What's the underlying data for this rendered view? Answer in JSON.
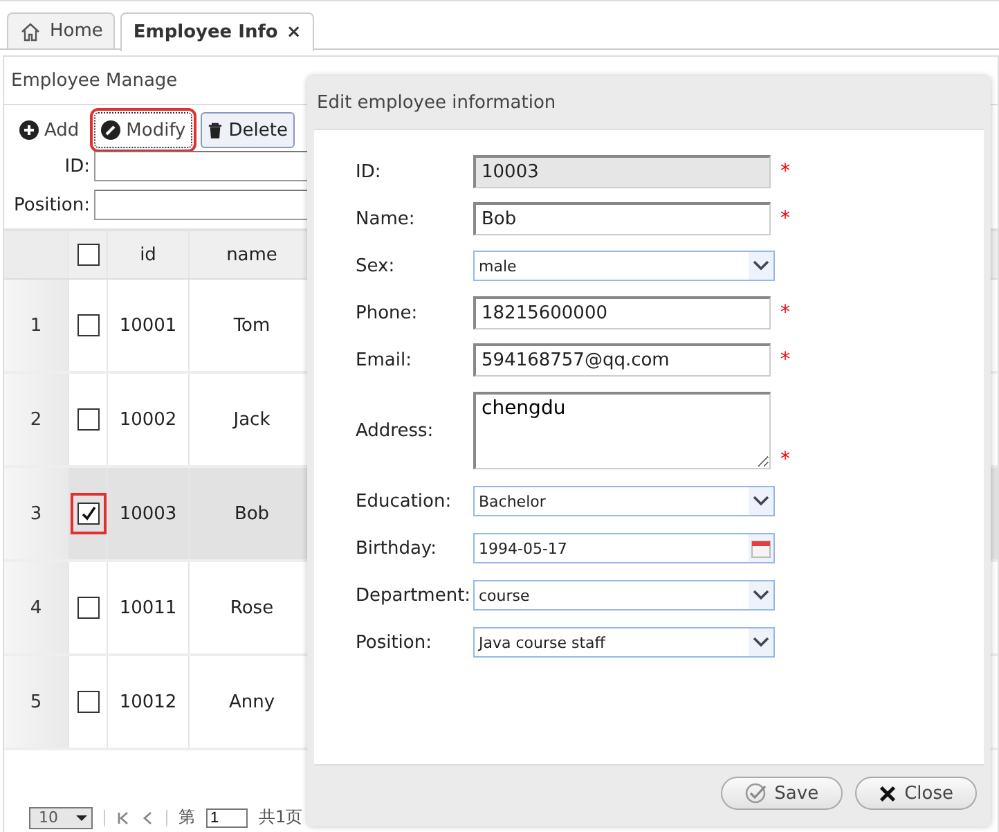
{
  "tabs": [
    {
      "label": "Home",
      "selected": false
    },
    {
      "label": "Employee Info",
      "close": "×",
      "selected": true
    }
  ],
  "panel": {
    "title": "Employee Manage",
    "toolbar": [
      {
        "label": "Add",
        "highlighted": false,
        "focused": false
      },
      {
        "label": "Modify",
        "highlighted": true,
        "focused": true
      },
      {
        "label": "Delete",
        "highlighted": false,
        "focused": false
      }
    ],
    "search": [
      {
        "label": "ID:"
      },
      {
        "label": "Position:"
      }
    ],
    "table": {
      "all_checked": false,
      "columns": [
        "id",
        "name"
      ],
      "rows": [
        {
          "num": "1",
          "checked": false,
          "selected": false,
          "highlighted": false,
          "cells": [
            "10001",
            "Tom"
          ]
        },
        {
          "num": "2",
          "checked": false,
          "selected": false,
          "highlighted": false,
          "cells": [
            "10002",
            "Jack"
          ]
        },
        {
          "num": "3",
          "checked": true,
          "selected": true,
          "highlighted": true,
          "cells": [
            "10003",
            "Bob"
          ]
        },
        {
          "num": "4",
          "checked": false,
          "selected": false,
          "highlighted": false,
          "cells": [
            "10011",
            "Rose"
          ]
        },
        {
          "num": "5",
          "checked": false,
          "selected": false,
          "highlighted": false,
          "cells": [
            "10012",
            "Anny"
          ]
        }
      ]
    },
    "pager": {
      "page_size": "10",
      "page_prefix": "第",
      "page": "1",
      "page_total": "共1页"
    }
  },
  "dialog": {
    "title": "Edit employee information",
    "fields": [
      {
        "label": "ID:",
        "kind": "readonly",
        "value": "10003",
        "required_mark": "*"
      },
      {
        "label": "Name:",
        "kind": "text",
        "value": "Bob",
        "required_mark": "*"
      },
      {
        "label": "Sex:",
        "kind": "select",
        "value": "male"
      },
      {
        "label": "Phone:",
        "kind": "text",
        "value": "18215600000",
        "required_mark": "*"
      },
      {
        "label": "Email:",
        "kind": "text",
        "value": "594168757@qq.com",
        "required_mark": "*"
      },
      {
        "label": "Address:",
        "kind": "textarea",
        "value": "chengdu",
        "required_mark": "*"
      },
      {
        "label": "Education:",
        "kind": "select",
        "value": "Bachelor"
      },
      {
        "label": "Birthday:",
        "kind": "date",
        "value": "1994-05-17"
      },
      {
        "label": "Department:",
        "kind": "select",
        "value": "course"
      },
      {
        "label": "Position:",
        "kind": "select",
        "value": "Java course staff"
      }
    ],
    "buttons": [
      {
        "label": "Save"
      },
      {
        "label": "Close"
      }
    ]
  }
}
